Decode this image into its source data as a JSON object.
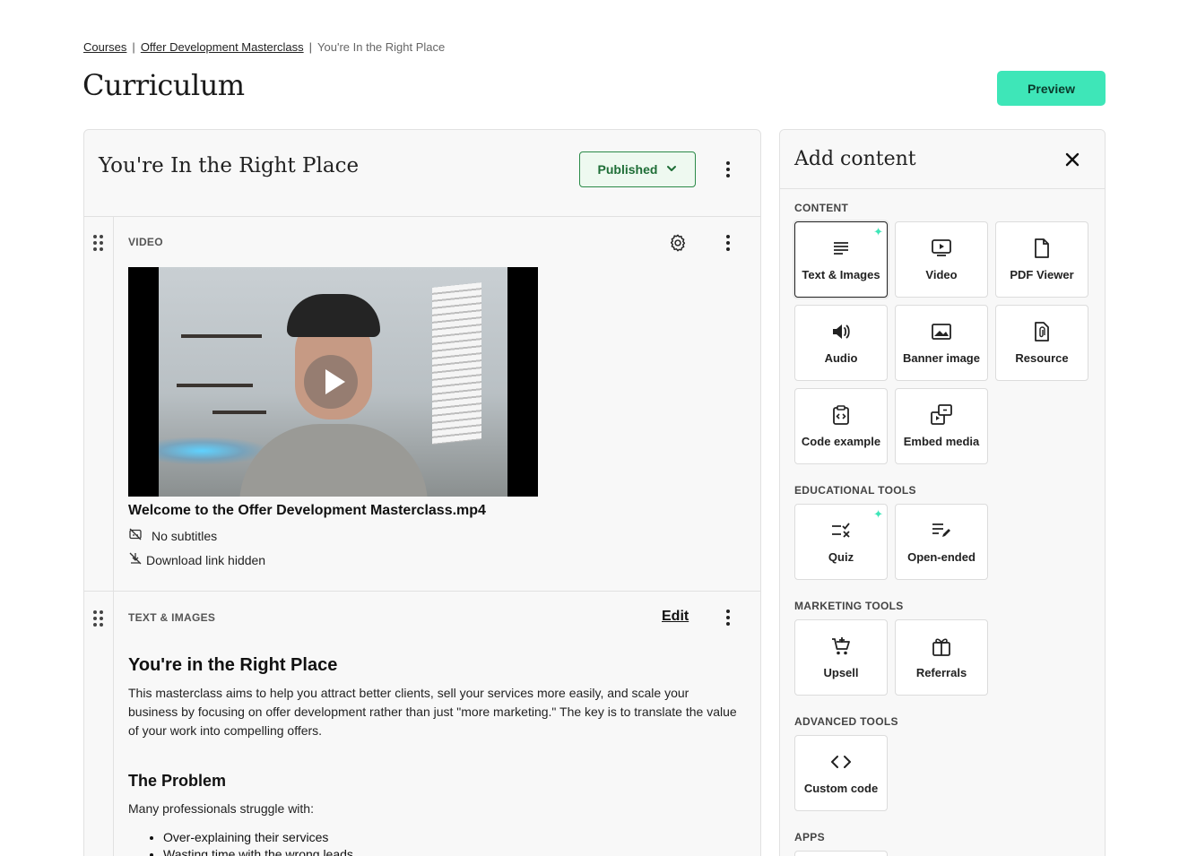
{
  "breadcrumb": {
    "items": [
      "Courses",
      "Offer Development Masterclass"
    ],
    "separator": "|",
    "current": "You're In the Right Place"
  },
  "page": {
    "title": "Curriculum"
  },
  "header": {
    "preview_label": "Preview"
  },
  "lesson": {
    "title": "You're In the Right Place",
    "status": "Published"
  },
  "video_block": {
    "label": "VIDEO",
    "filename": "Welcome to the Offer Development Masterclass.mp4",
    "subtitles": "No subtitles",
    "download": "Download link hidden"
  },
  "text_block": {
    "label": "TEXT & IMAGES",
    "edit_label": "Edit",
    "heading": "You're in the Right Place",
    "paragraph": "This masterclass aims to help you attract better clients, sell your services more easily, and scale your business by focusing on offer development rather than just \"more marketing.\" The key is to translate the value of your work into compelling offers.",
    "subheading": "The Problem",
    "subparagraph": "Many professionals struggle with:",
    "bullets": [
      "Over-explaining their services",
      "Wasting time with the wrong leads"
    ]
  },
  "add_content": {
    "title": "Add content",
    "sections": {
      "content": {
        "label": "CONTENT",
        "items": [
          "Text & Images",
          "Video",
          "PDF Viewer",
          "Audio",
          "Banner image",
          "Resource",
          "Code example",
          "Embed media"
        ]
      },
      "educational": {
        "label": "EDUCATIONAL TOOLS",
        "items": [
          "Quiz",
          "Open-ended"
        ]
      },
      "marketing": {
        "label": "MARKETING TOOLS",
        "items": [
          "Upsell",
          "Referrals"
        ]
      },
      "advanced": {
        "label": "ADVANCED TOOLS",
        "items": [
          "Custom code"
        ]
      },
      "apps": {
        "label": "APPS"
      }
    }
  },
  "colors": {
    "accent": "#3ee6b8",
    "published_border": "#2b8a48",
    "published_bg": "#eef9f0",
    "panel_bg": "#f8f8f8"
  }
}
